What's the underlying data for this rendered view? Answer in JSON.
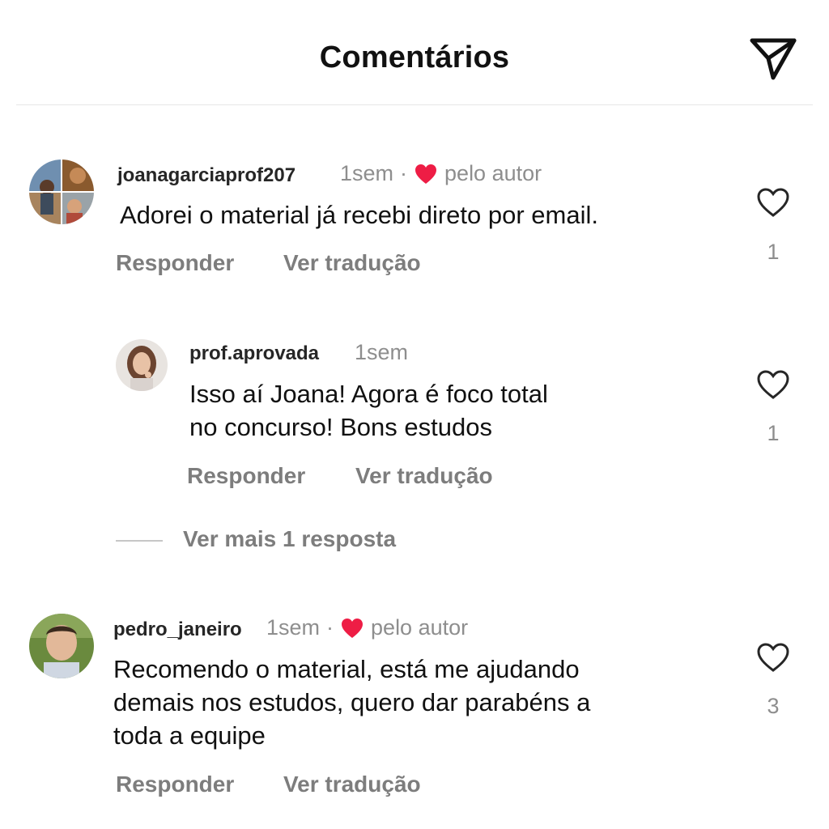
{
  "header": {
    "title": "Comentários",
    "send_icon": "send-paper-plane-icon"
  },
  "comments": [
    {
      "username": "joanagarciaprof207",
      "time": "1sem",
      "liked_by_author": "pelo autor",
      "text_lines": [
        "Adorei o material já recebi direto por email."
      ],
      "reply_label": "Responder",
      "translate_label": "Ver tradução",
      "like_count": "1"
    },
    {
      "username": "prof.aprovada",
      "time": "1sem",
      "text_lines": [
        "Isso aí Joana! Agora é foco total",
        "no concurso! Bons estudos"
      ],
      "reply_label": "Responder",
      "translate_label": "Ver tradução",
      "like_count": "1"
    },
    {
      "username": "pedro_janeiro",
      "time": "1sem",
      "liked_by_author": "pelo autor",
      "text_lines": [
        "Recomendo o material, está me ajudando",
        "demais nos estudos, quero dar parabéns a",
        "toda a equipe"
      ],
      "reply_label": "Responder",
      "translate_label": "Ver tradução",
      "like_count": "3"
    }
  ],
  "more_replies": "Ver mais 1 resposta",
  "colors": {
    "heart_red": "#ee1d45",
    "muted": "#8e8e8e",
    "action": "#7d7d7d"
  }
}
